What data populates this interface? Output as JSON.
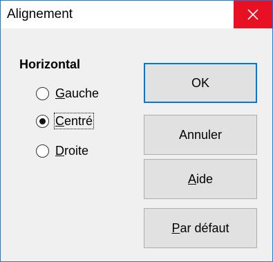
{
  "window": {
    "title": "Alignement"
  },
  "group": {
    "heading": "Horizontal",
    "options": [
      {
        "first": "G",
        "rest": "auche",
        "selected": false
      },
      {
        "first": "C",
        "rest": "entré",
        "selected": true
      },
      {
        "first": "D",
        "rest": "roite",
        "selected": false
      }
    ]
  },
  "buttons": {
    "ok": "OK",
    "cancel": "Annuler",
    "help_first": "A",
    "help_rest": "ide",
    "default_first": "P",
    "default_rest": "ar défaut"
  },
  "colors": {
    "close_bg": "#e81123",
    "focus_border": "#0078d7",
    "dialog_bg": "#f0f0f0"
  }
}
